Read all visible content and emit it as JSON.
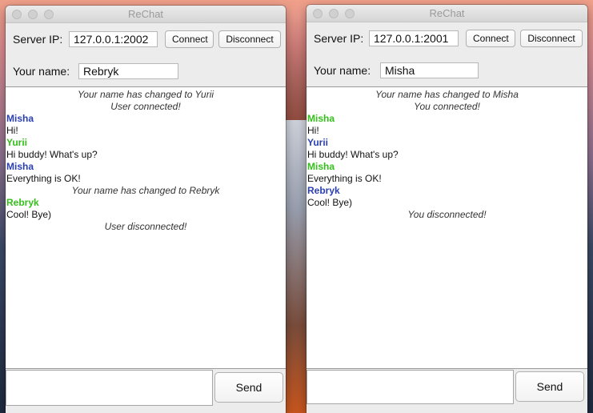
{
  "colors": {
    "blue_name": "#2a3fb3",
    "green_name": "#34c01a"
  },
  "windows": [
    {
      "title": "ReChat",
      "server_ip_label": "Server IP:",
      "server_ip_value": "127.0.0.1:2002",
      "connect_label": "Connect",
      "disconnect_label": "Disconnect",
      "name_label": "Your name:",
      "name_value": "Rebryk",
      "send_label": "Send",
      "messages": [
        {
          "kind": "system",
          "text": "Your name has changed to Yurii"
        },
        {
          "kind": "system",
          "text": "User connected!"
        },
        {
          "kind": "name",
          "text": "Misha",
          "color": "blue"
        },
        {
          "kind": "text",
          "text": "Hi!"
        },
        {
          "kind": "name",
          "text": "Yurii",
          "color": "green"
        },
        {
          "kind": "text",
          "text": "Hi buddy! What's up?"
        },
        {
          "kind": "name",
          "text": "Misha",
          "color": "blue"
        },
        {
          "kind": "text",
          "text": "Everything is OK!"
        },
        {
          "kind": "system",
          "text": "Your name has changed to Rebryk"
        },
        {
          "kind": "name",
          "text": "Rebryk",
          "color": "green"
        },
        {
          "kind": "text",
          "text": "Cool! Bye)"
        },
        {
          "kind": "system",
          "text": "User disconnected!"
        }
      ]
    },
    {
      "title": "ReChat",
      "server_ip_label": "Server IP:",
      "server_ip_value": "127.0.0.1:2001",
      "connect_label": "Connect",
      "disconnect_label": "Disconnect",
      "name_label": "Your name:",
      "name_value": "Misha",
      "send_label": "Send",
      "messages": [
        {
          "kind": "system",
          "text": "Your name has changed to Misha"
        },
        {
          "kind": "system",
          "text": "You connected!"
        },
        {
          "kind": "name",
          "text": "Misha",
          "color": "green"
        },
        {
          "kind": "text",
          "text": "Hi!"
        },
        {
          "kind": "name",
          "text": "Yurii",
          "color": "blue"
        },
        {
          "kind": "text",
          "text": "Hi buddy! What's up?"
        },
        {
          "kind": "name",
          "text": "Misha",
          "color": "green"
        },
        {
          "kind": "text",
          "text": "Everything is OK!"
        },
        {
          "kind": "name",
          "text": "Rebryk",
          "color": "blue"
        },
        {
          "kind": "text",
          "text": "Cool! Bye)"
        },
        {
          "kind": "system",
          "text": "You disconnected!"
        }
      ]
    }
  ]
}
